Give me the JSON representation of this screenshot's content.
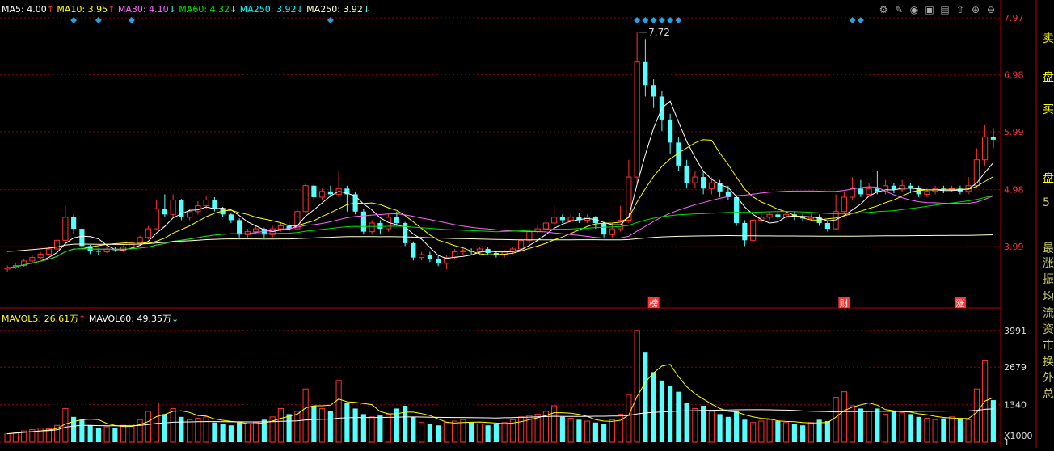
{
  "ma_legend": [
    {
      "label": "MA5: ",
      "value": "4.00",
      "arrow": "↑",
      "color": "#ffffff"
    },
    {
      "label": "MA10: ",
      "value": "3.95",
      "arrow": "↑",
      "color": "#ffff00"
    },
    {
      "label": "MA30: ",
      "value": "4.10",
      "arrow": "↓",
      "color": "#ff66ff"
    },
    {
      "label": "MA60: ",
      "value": "4.32",
      "arrow": "↓",
      "color": "#00e000"
    },
    {
      "label": "MA250: ",
      "value": "3.92",
      "arrow": "↓",
      "color": "#00ffff"
    },
    {
      "label": "MA250: ",
      "value": "3.92",
      "arrow": "↓",
      "color": "#ffffcc"
    }
  ],
  "vol_legend": [
    {
      "label": "MAVOL5: ",
      "value": "26.61万",
      "arrow": "↑",
      "color": "#ffff00"
    },
    {
      "label": "MAVOL60: ",
      "value": "49.35万",
      "arrow": "↓",
      "color": "#ffffff"
    }
  ],
  "right_panel_chars": [
    "卖",
    "盘",
    "买",
    "盘",
    "5",
    "最",
    "涨",
    "振",
    "均",
    "流",
    "资",
    "市",
    "换",
    "外",
    "总"
  ],
  "icons": [
    "settings-icon",
    "draw-icon",
    "view-icon",
    "gift-icon",
    "lock-icon",
    "upload-icon",
    "zoom-in-icon",
    "zoom-out-icon"
  ],
  "chart_data": [
    {
      "type": "candlestick",
      "price_ticks": [
        "7.97",
        "6.98",
        "5.99",
        "4.98",
        "3.99"
      ],
      "ylim": [
        3.5,
        7.97
      ],
      "high_label": "7.72",
      "markers": [
        "榜",
        "财",
        "涨"
      ],
      "ma_lines": [
        "MA5",
        "MA10",
        "MA30",
        "MA60",
        "MA250"
      ],
      "up_color": "#ff3232",
      "down_color": "#54ffff",
      "candles": [
        [
          3.6,
          3.62,
          3.55,
          3.66
        ],
        [
          3.62,
          3.66,
          3.6,
          3.7
        ],
        [
          3.66,
          3.74,
          3.64,
          3.78
        ],
        [
          3.74,
          3.8,
          3.72,
          3.84
        ],
        [
          3.8,
          3.86,
          3.78,
          3.9
        ],
        [
          3.86,
          3.95,
          3.84,
          3.98
        ],
        [
          3.95,
          4.1,
          3.92,
          4.15
        ],
        [
          4.1,
          4.5,
          4.05,
          4.7
        ],
        [
          4.5,
          4.3,
          4.2,
          4.55
        ],
        [
          4.3,
          4.0,
          3.95,
          4.32
        ],
        [
          4.0,
          3.92,
          3.86,
          4.02
        ],
        [
          3.92,
          3.9,
          3.85,
          3.96
        ],
        [
          3.9,
          3.95,
          3.88,
          3.98
        ],
        [
          3.95,
          3.93,
          3.9,
          3.99
        ],
        [
          3.93,
          3.98,
          3.9,
          4.01
        ],
        [
          3.98,
          4.05,
          3.95,
          4.08
        ],
        [
          4.05,
          4.15,
          4.02,
          4.18
        ],
        [
          4.15,
          4.3,
          4.12,
          4.35
        ],
        [
          4.3,
          4.65,
          4.28,
          4.8
        ],
        [
          4.65,
          4.55,
          4.5,
          4.9
        ],
        [
          4.55,
          4.8,
          4.5,
          4.9
        ],
        [
          4.8,
          4.5,
          4.45,
          4.82
        ],
        [
          4.5,
          4.6,
          4.45,
          4.65
        ],
        [
          4.6,
          4.7,
          4.55,
          4.78
        ],
        [
          4.7,
          4.8,
          4.65,
          4.86
        ],
        [
          4.8,
          4.65,
          4.6,
          4.85
        ],
        [
          4.65,
          4.55,
          4.5,
          4.68
        ],
        [
          4.55,
          4.45,
          4.4,
          4.58
        ],
        [
          4.45,
          4.2,
          4.15,
          4.48
        ],
        [
          4.2,
          4.25,
          4.15,
          4.3
        ],
        [
          4.25,
          4.3,
          4.2,
          4.36
        ],
        [
          4.3,
          4.2,
          4.15,
          4.32
        ],
        [
          4.2,
          4.3,
          4.15,
          4.35
        ],
        [
          4.3,
          4.35,
          4.25,
          4.4
        ],
        [
          4.35,
          4.3,
          4.25,
          4.42
        ],
        [
          4.3,
          4.6,
          4.28,
          4.65
        ],
        [
          4.6,
          5.05,
          4.58,
          5.1
        ],
        [
          5.05,
          4.85,
          4.8,
          5.1
        ],
        [
          4.85,
          4.95,
          4.8,
          5.0
        ],
        [
          4.95,
          4.9,
          4.85,
          5.05
        ],
        [
          4.9,
          5.0,
          4.85,
          5.3
        ],
        [
          5.0,
          4.9,
          4.6,
          5.05
        ],
        [
          4.9,
          4.6,
          4.55,
          4.95
        ],
        [
          4.6,
          4.25,
          4.2,
          4.65
        ],
        [
          4.25,
          4.4,
          4.2,
          4.45
        ],
        [
          4.4,
          4.3,
          4.2,
          4.45
        ],
        [
          4.3,
          4.5,
          4.25,
          4.55
        ],
        [
          4.5,
          4.4,
          4.35,
          4.6
        ],
        [
          4.4,
          4.05,
          4.0,
          4.42
        ],
        [
          4.05,
          3.8,
          3.75,
          4.08
        ],
        [
          3.8,
          3.85,
          3.75,
          3.9
        ],
        [
          3.85,
          3.78,
          3.72,
          3.9
        ],
        [
          3.78,
          3.7,
          3.65,
          3.82
        ],
        [
          3.7,
          3.8,
          3.6,
          3.84
        ],
        [
          3.8,
          3.9,
          3.78,
          3.95
        ],
        [
          3.9,
          3.92,
          3.85,
          3.96
        ],
        [
          3.92,
          3.9,
          3.85,
          3.96
        ],
        [
          3.9,
          3.95,
          3.85,
          3.98
        ],
        [
          3.95,
          3.88,
          3.84,
          3.98
        ],
        [
          3.88,
          3.85,
          3.8,
          3.92
        ],
        [
          3.85,
          3.9,
          3.8,
          3.93
        ],
        [
          3.9,
          3.95,
          3.86,
          3.98
        ],
        [
          3.95,
          4.1,
          3.92,
          4.15
        ],
        [
          4.1,
          4.25,
          4.05,
          4.3
        ],
        [
          4.25,
          4.3,
          4.2,
          4.36
        ],
        [
          4.3,
          4.4,
          4.25,
          4.45
        ],
        [
          4.4,
          4.5,
          4.35,
          4.7
        ],
        [
          4.5,
          4.45,
          4.4,
          4.55
        ],
        [
          4.45,
          4.5,
          4.42,
          4.55
        ],
        [
          4.5,
          4.45,
          4.4,
          4.58
        ],
        [
          4.45,
          4.5,
          4.4,
          4.55
        ],
        [
          4.5,
          4.4,
          4.3,
          4.52
        ],
        [
          4.4,
          4.2,
          4.15,
          4.42
        ],
        [
          4.2,
          4.3,
          4.15,
          4.4
        ],
        [
          4.3,
          4.45,
          4.25,
          4.7
        ],
        [
          4.45,
          5.2,
          4.4,
          5.5
        ],
        [
          5.2,
          7.2,
          5.1,
          7.72
        ],
        [
          7.2,
          6.8,
          6.6,
          7.6
        ],
        [
          6.8,
          6.6,
          6.4,
          6.9
        ],
        [
          6.6,
          6.2,
          6.0,
          6.7
        ],
        [
          6.2,
          5.8,
          5.6,
          6.3
        ],
        [
          5.8,
          5.4,
          5.3,
          5.9
        ],
        [
          5.4,
          5.1,
          5.0,
          5.5
        ],
        [
          5.1,
          5.2,
          5.0,
          5.3
        ],
        [
          5.2,
          5.0,
          4.9,
          5.3
        ],
        [
          5.0,
          5.1,
          4.9,
          5.2
        ],
        [
          5.1,
          4.95,
          4.85,
          5.15
        ],
        [
          4.95,
          4.85,
          4.8,
          5.05
        ],
        [
          4.85,
          4.4,
          4.35,
          4.88
        ],
        [
          4.4,
          4.1,
          4.0,
          4.45
        ],
        [
          4.1,
          4.45,
          4.05,
          4.5
        ],
        [
          4.45,
          4.5,
          4.4,
          4.6
        ],
        [
          4.5,
          4.55,
          4.45,
          4.6
        ],
        [
          4.55,
          4.5,
          4.45,
          4.62
        ],
        [
          4.5,
          4.55,
          4.45,
          4.62
        ],
        [
          4.55,
          4.5,
          4.45,
          4.6
        ],
        [
          4.5,
          4.48,
          4.42,
          4.56
        ],
        [
          4.48,
          4.5,
          4.44,
          4.56
        ],
        [
          4.5,
          4.4,
          4.35,
          4.55
        ],
        [
          4.4,
          4.3,
          4.25,
          4.45
        ],
        [
          4.3,
          4.6,
          4.28,
          4.9
        ],
        [
          4.6,
          4.85,
          4.55,
          4.95
        ],
        [
          4.85,
          5.0,
          4.8,
          5.2
        ],
        [
          5.0,
          4.9,
          4.85,
          5.15
        ],
        [
          4.9,
          5.0,
          4.85,
          5.1
        ],
        [
          5.0,
          4.95,
          4.9,
          5.3
        ],
        [
          4.95,
          5.05,
          4.9,
          5.15
        ],
        [
          5.05,
          4.98,
          4.92,
          5.1
        ],
        [
          4.98,
          5.05,
          4.94,
          5.15
        ],
        [
          5.05,
          5.0,
          4.92,
          5.1
        ],
        [
          5.0,
          4.9,
          4.85,
          5.05
        ],
        [
          4.9,
          4.95,
          4.85,
          5.0
        ],
        [
          4.95,
          5.0,
          4.9,
          5.05
        ],
        [
          5.0,
          4.98,
          4.92,
          5.05
        ],
        [
          4.98,
          5.0,
          4.94,
          5.05
        ],
        [
          5.0,
          4.95,
          4.9,
          5.05
        ],
        [
          4.95,
          5.05,
          4.9,
          5.2
        ],
        [
          5.05,
          5.5,
          5.0,
          5.7
        ],
        [
          5.5,
          5.9,
          5.4,
          6.1
        ],
        [
          5.9,
          5.85,
          5.7,
          6.05
        ]
      ],
      "volumes": [
        300,
        350,
        400,
        450,
        500,
        480,
        600,
        1200,
        900,
        800,
        600,
        500,
        550,
        520,
        600,
        650,
        800,
        1100,
        1400,
        1000,
        1200,
        900,
        800,
        850,
        900,
        700,
        650,
        600,
        700,
        650,
        700,
        800,
        900,
        1200,
        1000,
        1100,
        1900,
        1300,
        1200,
        1100,
        2200,
        1400,
        1200,
        1000,
        900,
        950,
        1000,
        1200,
        1300,
        900,
        700,
        650,
        600,
        700,
        750,
        800,
        700,
        650,
        600,
        650,
        700,
        800,
        900,
        950,
        1000,
        1100,
        1300,
        900,
        850,
        800,
        750,
        700,
        650,
        800,
        1000,
        1700,
        3991,
        3200,
        2500,
        2200,
        2000,
        1800,
        1400,
        1200,
        1300,
        1100,
        1000,
        900,
        1100,
        800,
        700,
        750,
        800,
        750,
        700,
        650,
        600,
        700,
        800,
        750,
        1600,
        1800,
        1300,
        1200,
        1100,
        1200,
        1000,
        1100,
        1050,
        1000,
        900,
        850,
        800,
        850,
        900,
        850,
        800,
        1900,
        2900,
        1500
      ],
      "vol_ticks": [
        "3991",
        "2679",
        "1340",
        "1"
      ],
      "vol_ylim": [
        0,
        4100
      ],
      "vol_unit": "X1000"
    }
  ]
}
